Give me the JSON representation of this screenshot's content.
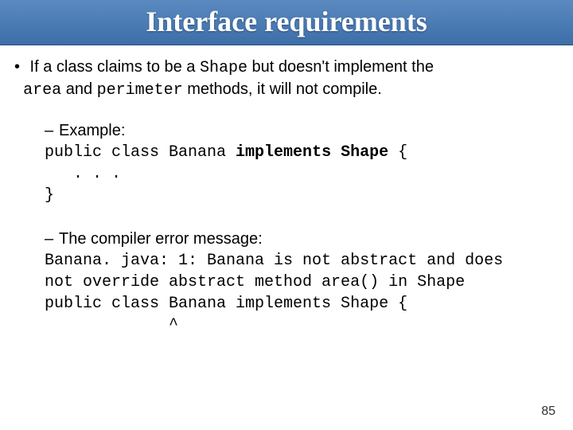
{
  "title": "Interface requirements",
  "bullet": {
    "part1": " If a class claims to be a ",
    "code1": "Shape",
    "part2": " but doesn't implement the",
    "code2": "area",
    "part3": " and ",
    "code3": "perimeter",
    "part4": " methods, it will not compile."
  },
  "example": {
    "label": "Example:",
    "code": {
      "l1a": "public class Banana ",
      "kw": "implements Shape",
      "l1b": " {",
      "l2": "   . . .",
      "l3": "}"
    }
  },
  "error": {
    "label": "The compiler error message:",
    "code": {
      "l1": "Banana. java: 1: Banana is not abstract and does",
      "l2": "not override abstract method area() in Shape",
      "l3": "public class Banana implements Shape {",
      "l4": "             ^"
    }
  },
  "slide_number": "85"
}
